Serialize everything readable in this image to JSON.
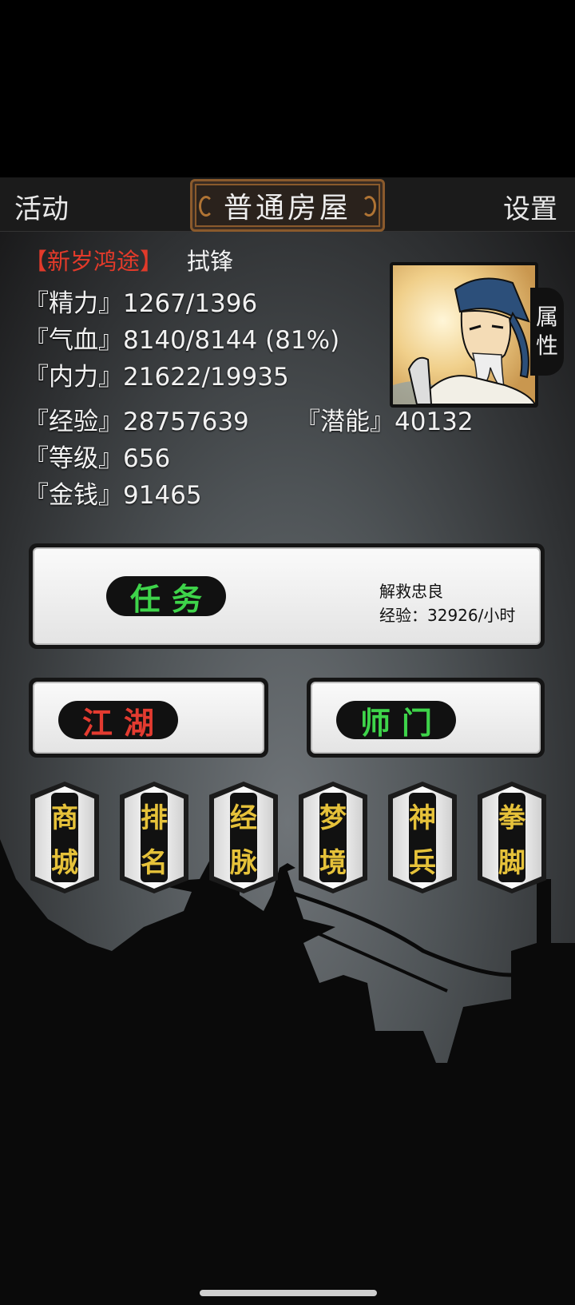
{
  "header": {
    "left": "活动",
    "title": "普通房屋",
    "right": "设置"
  },
  "player": {
    "title_tag": "【新岁鸿途】",
    "name": "拭锋"
  },
  "stats": {
    "jingli": "『精力』1267/1396",
    "qixue": "『气血』8140/8144 (81%)",
    "neili": "『内力』21622/19935",
    "jingyan": "『经验』28757639",
    "qianneng": "『潜能』40132",
    "dengji": "『等级』656",
    "jinqian": "『金钱』91465"
  },
  "attr_tab": {
    "c1": "属",
    "c2": "性"
  },
  "task": {
    "label": "任务",
    "info1": "解救忠良",
    "info2": "经验：32926/小时"
  },
  "jianghu": {
    "label": "江湖"
  },
  "shimen": {
    "label": "师门"
  },
  "menu": [
    {
      "c1": "商",
      "c2": "城"
    },
    {
      "c1": "排",
      "c2": "名"
    },
    {
      "c1": "经",
      "c2": "脉"
    },
    {
      "c1": "梦",
      "c2": "境"
    },
    {
      "c1": "神",
      "c2": "兵"
    },
    {
      "c1": "拳",
      "c2": "脚"
    }
  ]
}
